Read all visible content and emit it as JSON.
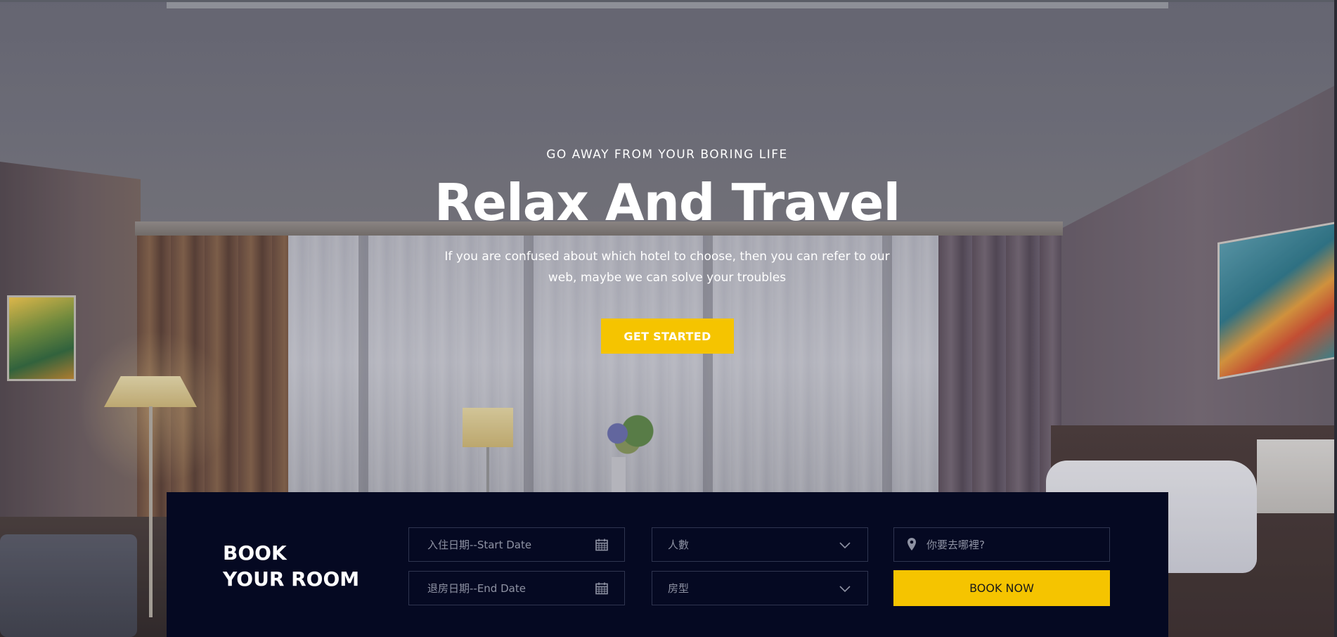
{
  "hero": {
    "eyebrow": "GO AWAY FROM YOUR BORING LIFE",
    "title": "Relax And Travel",
    "subtitle": "If you are confused about which hotel to choose, then you can refer to our web, maybe we can solve your troubles",
    "cta_label": "GET STARTED"
  },
  "booking": {
    "title_line1": "BOOK",
    "title_line2": "YOUR ROOM",
    "start_date_placeholder": "入住日期--Start Date",
    "end_date_placeholder": "退房日期--End Date",
    "guests_placeholder": "人數",
    "room_type_placeholder": "房型",
    "destination_placeholder": "你要去哪裡?",
    "book_now_label": "BOOK NOW",
    "icons": {
      "start_date": "calendar-icon",
      "end_date": "calendar-icon",
      "guests": "chevron-down-icon",
      "room_type": "chevron-down-icon",
      "destination": "map-pin-icon"
    }
  },
  "colors": {
    "accent": "#f5c400",
    "booking_bg": "#050922",
    "field_border": "#2f3550",
    "placeholder_text": "#8e92a3"
  }
}
